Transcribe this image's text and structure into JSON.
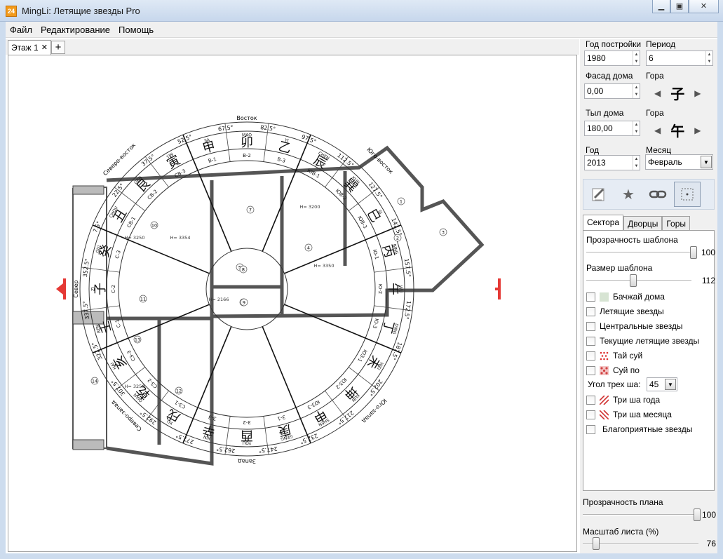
{
  "window": {
    "icon_text": "24",
    "title": "MingLi: Летящие звезды Pro",
    "minimize": "▁",
    "maximize": "▣",
    "close": "✕"
  },
  "menu": [
    "Файл",
    "Редактирование",
    "Помощь"
  ],
  "tabs": {
    "floor_tab": "Этаж 1",
    "close_glyph": "✕",
    "add_glyph": "+"
  },
  "plan": {
    "east_label": "Восток",
    "west_label": "Запад",
    "north_label": "Север",
    "degrees": [
      "67.5°",
      "82.5°",
      "97.5°",
      "112.5°",
      "127.5°",
      "142.5°",
      "157.5°",
      "172.5°",
      "187.5°",
      "202.5°",
      "217.5°",
      "232.5°",
      "247.5°",
      "262.5°",
      "277.5°",
      "292.5°",
      "307.5°",
      "322.5°",
      "337.5°",
      "352.5°",
      "7.5°",
      "22.5°",
      "37.5°",
      "52.5°"
    ],
    "mountains": [
      "卯",
      "乙",
      "辰",
      "巽",
      "巳",
      "丙",
      "午",
      "丁",
      "未",
      "坤",
      "申",
      "庚",
      "酉",
      "辛",
      "戌",
      "乾",
      "亥",
      "壬",
      "子",
      "癸",
      "丑",
      "艮",
      "寅",
      "甲"
    ],
    "pinyin": [
      "MAO",
      "YI",
      "CHEN",
      "XUN",
      "SI",
      "BING",
      "WU",
      "DING",
      "WEI",
      "KUN",
      "SHEN",
      "GENG",
      "YOU",
      "XIN",
      "XU",
      "QIAN",
      "HAI",
      "REN",
      "ZI",
      "GUI",
      "CHOU",
      "GEN",
      "YIN",
      "JIA"
    ],
    "sector_codes": [
      "В-2",
      "В-3",
      "ЮВ-1",
      "ЮВ-2",
      "ЮВ-3",
      "Ю-1",
      "Ю-2",
      "Ю-3",
      "ЮЗ-1",
      "ЮЗ-2",
      "ЮЗ-3",
      "З-1",
      "З-2",
      "З-3",
      "СЗ-1",
      "СЗ-2",
      "СЗ-3",
      "С-1",
      "С-2",
      "С-3",
      "СВ-1",
      "СВ-2",
      "СВ-3",
      "В-1"
    ],
    "corner_labels": {
      "ne": "Северо-восток",
      "se": "Юго-восток",
      "sw": "Юго-запад",
      "nw": "Северо-запад"
    },
    "room_heights": [
      "H= 3200",
      "H= 3250",
      "H= 3354",
      "H= 3350",
      "H= 2166",
      "H= 3250"
    ],
    "room_numbers": [
      "1",
      "2",
      "3",
      "4",
      "5",
      "6",
      "7",
      "8",
      "9",
      "10",
      "11",
      "12",
      "13",
      "14"
    ]
  },
  "panel": {
    "year_built_label": "Год постройки",
    "year_built": "1980",
    "period_label": "Период",
    "period": "6",
    "facade_label": "Фасад дома",
    "facade": "0,00",
    "facade_mountain_label": "Гора",
    "facade_mountain": "子",
    "rear_label": "Тыл дома",
    "rear": "180,00",
    "rear_mountain_label": "Гора",
    "rear_mountain": "午",
    "year_label": "Год",
    "year": "2013",
    "month_label": "Месяц",
    "month": "Февраль",
    "tools": [
      "pencil-icon",
      "star-icon",
      "link-icon",
      "frame-icon"
    ],
    "sub_tabs": [
      "Сектора",
      "Дворцы",
      "Горы"
    ],
    "template_opacity_label": "Прозрачность шаблона",
    "template_opacity": "100",
    "template_size_label": "Размер шаблона",
    "template_size": "112",
    "checks": [
      "Бачжай дома",
      "Летящие звезды",
      "Центральные звезды",
      "Текущие летящие звезды",
      "Тай суй",
      "Суй по"
    ],
    "three_sha_angle_label": "Угол трех ша:",
    "three_sha_angle": "45",
    "checks2": [
      "Три ша года",
      "Три ша месяца",
      "Благоприятные звезды"
    ],
    "plan_opacity_label": "Прозрачность плана",
    "plan_opacity": "100",
    "sheet_scale_label": "Масштаб листа (%)",
    "sheet_scale": "76",
    "colors": {
      "bazhai_swatch": "#d7e4d3",
      "tai_sui": "#e03030",
      "sha_red": "#d03030",
      "accent_red": "#e53935"
    }
  }
}
